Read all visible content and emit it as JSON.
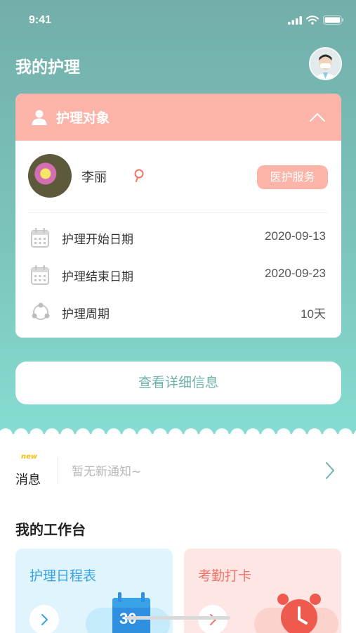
{
  "status_bar": {
    "time": "9:41"
  },
  "header": {
    "title": "我的护理"
  },
  "care_card": {
    "title": "护理对象",
    "patient_name": "李丽",
    "service_badge": "医护服务",
    "rows": [
      {
        "label": "护理开始日期",
        "value": "2020-09-13"
      },
      {
        "label": "护理结束日期",
        "value": "2020-09-23"
      },
      {
        "label": "护理周期",
        "value": "10天"
      }
    ]
  },
  "detail_button": {
    "label": "查看详细信息"
  },
  "messages": {
    "new_tag": "new",
    "label": "消息",
    "text": "暂无新通知~"
  },
  "workbench": {
    "title": "我的工作台",
    "tiles": [
      {
        "title": "护理日程表",
        "calendar_day": "30"
      },
      {
        "title": "考勤打卡"
      }
    ]
  },
  "colors": {
    "hero_top": "#73aeaa",
    "hero_bottom": "#86ddd1",
    "card_header": "#fdb4a8",
    "accent_teal": "#6fb1ab",
    "schedule_blue": "#3aa2e6",
    "attend_red": "#f3736a"
  }
}
